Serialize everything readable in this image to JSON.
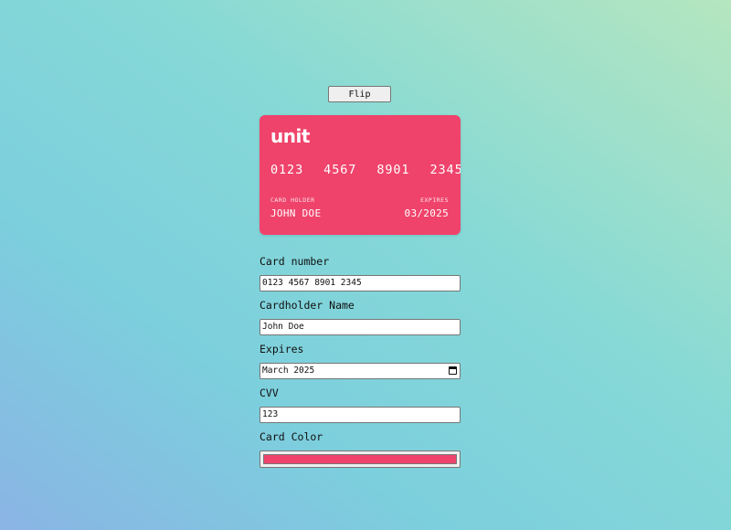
{
  "flip_button": {
    "label": "Flip"
  },
  "card": {
    "logo": "unit",
    "number": "0123  4567  8901  2345",
    "holder_label": "CARD HOLDER",
    "holder_value": "JOHN DOE",
    "expires_label": "EXPIRES",
    "expires_value": "03/2025",
    "color": "#ef436b",
    "icons": {
      "expires_picker": "calendar-icon"
    }
  },
  "form": {
    "card_number": {
      "label": "Card number",
      "value": "0123 4567 8901 2345"
    },
    "cardholder_name": {
      "label": "Cardholder Name",
      "value": "John Doe"
    },
    "expires": {
      "label": "Expires",
      "value": "March 2025"
    },
    "cvv": {
      "label": "CVV",
      "value": "123"
    },
    "card_color": {
      "label": "Card Color",
      "value": "#ef436b"
    }
  }
}
